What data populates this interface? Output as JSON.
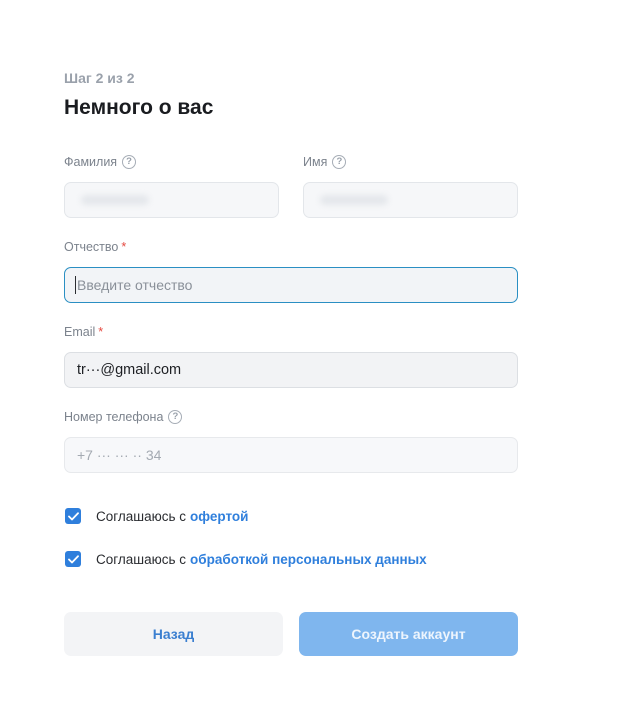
{
  "header": {
    "step": "Шаг 2 из 2",
    "title": "Немного о вас"
  },
  "fields": {
    "last_name": {
      "label": "Фамилия",
      "help_icon": "question-circle-icon"
    },
    "first_name": {
      "label": "Имя",
      "help_icon": "question-circle-icon"
    },
    "patronymic": {
      "label": "Отчество",
      "required_mark": "*",
      "placeholder": "Введите отчество"
    },
    "email": {
      "label": "Email",
      "required_mark": "*",
      "value": "tr···@gmail.com"
    },
    "phone": {
      "label": "Номер телефона",
      "help_icon": "question-circle-icon",
      "value": "+7 ··· ··· ·· 34"
    }
  },
  "agreements": [
    {
      "text": "Соглашаюсь с",
      "link": "офертой",
      "checked": true
    },
    {
      "text": "Соглашаюсь с",
      "link": "обработкой персональных данных",
      "checked": true
    }
  ],
  "buttons": {
    "back_label": "Назад",
    "create_label": "Создать аккаунт"
  },
  "colors": {
    "accent": "#2f7fdc",
    "required": "#e5483f",
    "focus_border": "#2a8fc3",
    "primary_disabled": "#7fb6ee"
  }
}
